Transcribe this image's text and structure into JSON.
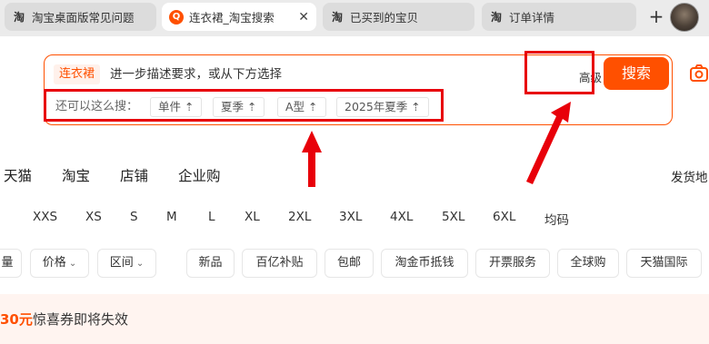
{
  "tabs": [
    {
      "label": "淘宝桌面版常见问题",
      "favicon": "淘"
    },
    {
      "label": "连衣裙_淘宝搜索",
      "favicon": "Q",
      "active": true
    },
    {
      "label": "已买到的宝贝",
      "favicon": "淘"
    },
    {
      "label": "订单详情",
      "favicon": "淘"
    }
  ],
  "new_tab_label": "+",
  "tab_close_label": "✕",
  "search": {
    "keyword": "连衣裙",
    "placeholder": "进一步描述要求，或从下方选择",
    "advanced_label": "高级",
    "advanced_on": true,
    "suggest_label": "还可以这么搜：",
    "suggestions": [
      "单件 ⇡",
      "夏季 ⇡",
      "A型 ⇡",
      "2025年夏季 ⇡"
    ],
    "button_label": "搜索"
  },
  "platforms": [
    "天猫",
    "淘宝",
    "店铺",
    "企业购"
  ],
  "ship_from": "发货地",
  "sizes": [
    "XXS",
    "XS",
    "S",
    "M",
    "L",
    "XL",
    "2XL",
    "3XL",
    "4XL",
    "5XL",
    "6XL",
    "均码"
  ],
  "filters": {
    "sort_partial": "量",
    "price": "价格",
    "range": "区间",
    "tags": [
      "新品",
      "百亿补贴",
      "包邮",
      "淘金币抵钱",
      "开票服务",
      "全球购",
      "天猫国际"
    ]
  },
  "coupon": {
    "amount": "30元",
    "text": "惊喜券即将失效"
  },
  "colors": {
    "accent": "#ff5000",
    "annotation": "#e8000a"
  }
}
